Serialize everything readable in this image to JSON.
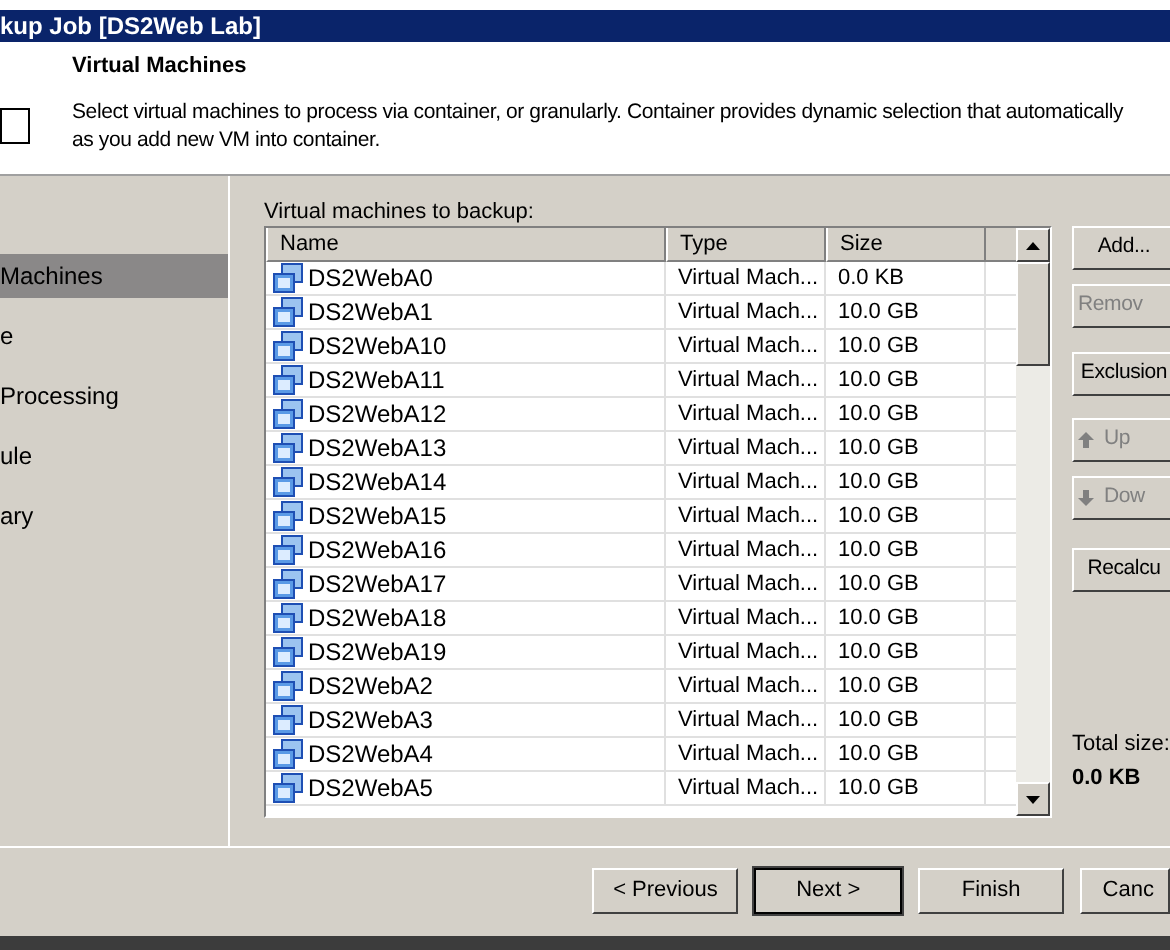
{
  "window": {
    "title": "kup Job [DS2Web Lab]"
  },
  "header": {
    "title": "Virtual Machines",
    "description": [
      "Select virtual machines to process via container, or granularly. Container provides dynamic selection that automatically",
      "as you add new VM into container."
    ]
  },
  "sidebar": {
    "items": [
      {
        "label": "Machines",
        "selected": true
      },
      {
        "label": "e",
        "selected": false
      },
      {
        "label": "Processing",
        "selected": false
      },
      {
        "label": "ule",
        "selected": false
      },
      {
        "label": "ary",
        "selected": false
      }
    ]
  },
  "list_label": "Virtual machines to backup:",
  "table": {
    "columns": [
      "Name",
      "Type",
      "Size"
    ],
    "rows": [
      {
        "name": "DS2WebA0",
        "type": "Virtual Mach...",
        "size": "0.0 KB"
      },
      {
        "name": "DS2WebA1",
        "type": "Virtual Mach...",
        "size": "10.0 GB"
      },
      {
        "name": "DS2WebA10",
        "type": "Virtual Mach...",
        "size": "10.0 GB"
      },
      {
        "name": "DS2WebA11",
        "type": "Virtual Mach...",
        "size": "10.0 GB"
      },
      {
        "name": "DS2WebA12",
        "type": "Virtual Mach...",
        "size": "10.0 GB"
      },
      {
        "name": "DS2WebA13",
        "type": "Virtual Mach...",
        "size": "10.0 GB"
      },
      {
        "name": "DS2WebA14",
        "type": "Virtual Mach...",
        "size": "10.0 GB"
      },
      {
        "name": "DS2WebA15",
        "type": "Virtual Mach...",
        "size": "10.0 GB"
      },
      {
        "name": "DS2WebA16",
        "type": "Virtual Mach...",
        "size": "10.0 GB"
      },
      {
        "name": "DS2WebA17",
        "type": "Virtual Mach...",
        "size": "10.0 GB"
      },
      {
        "name": "DS2WebA18",
        "type": "Virtual Mach...",
        "size": "10.0 GB"
      },
      {
        "name": "DS2WebA19",
        "type": "Virtual Mach...",
        "size": "10.0 GB"
      },
      {
        "name": "DS2WebA2",
        "type": "Virtual Mach...",
        "size": "10.0 GB"
      },
      {
        "name": "DS2WebA3",
        "type": "Virtual Mach...",
        "size": "10.0 GB"
      },
      {
        "name": "DS2WebA4",
        "type": "Virtual Mach...",
        "size": "10.0 GB"
      },
      {
        "name": "DS2WebA5",
        "type": "Virtual Mach...",
        "size": "10.0 GB"
      }
    ]
  },
  "side_buttons": [
    {
      "label": "Add...",
      "disabled": false,
      "kind": "plain"
    },
    {
      "label": "Remov",
      "disabled": true,
      "kind": "plain"
    },
    {
      "label": "Exclusion",
      "disabled": false,
      "kind": "plain"
    },
    {
      "label": "Up",
      "disabled": true,
      "kind": "up"
    },
    {
      "label": "Dow",
      "disabled": true,
      "kind": "down"
    },
    {
      "label": "Recalcu",
      "disabled": false,
      "kind": "plain"
    }
  ],
  "total": {
    "label": "Total size:",
    "value": "0.0 KB"
  },
  "footer_buttons": [
    {
      "label": "< Previous",
      "default": false
    },
    {
      "label": "Next >",
      "default": true
    },
    {
      "label": "Finish",
      "default": false
    },
    {
      "label": "Canc",
      "default": false
    }
  ]
}
